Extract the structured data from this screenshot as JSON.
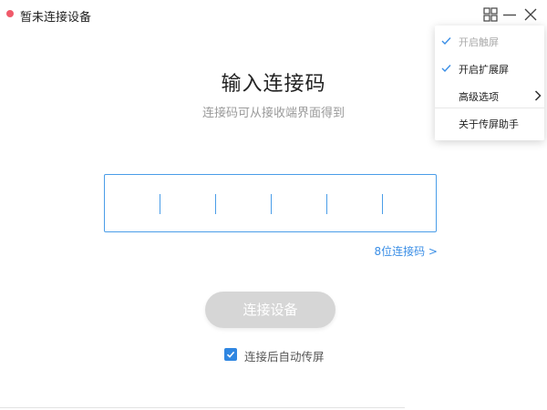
{
  "window": {
    "title": "暂未连接设备",
    "accent": "#4a9de8",
    "status_dot_color": "#f05a6a"
  },
  "titlebar_icons": [
    "grid-icon",
    "minimize-icon",
    "close-icon"
  ],
  "main": {
    "title": "输入连接码",
    "subtitle": "连接码可从接收端界面得到",
    "code_input": {
      "slots": 6,
      "value": ""
    },
    "code_length_link": "8位连接码 >",
    "connect_button": "连接设备",
    "auto_screen_checkbox": {
      "label": "连接后自动传屏",
      "checked": true
    }
  },
  "menu": {
    "items": [
      {
        "label": "开启触屏",
        "checked": true,
        "disabled": true
      },
      {
        "label": "开启扩展屏",
        "checked": true,
        "disabled": false
      },
      {
        "label": "高级选项",
        "checked": false,
        "submenu": true
      },
      {
        "label": "关于传屏助手",
        "checked": false
      }
    ]
  }
}
